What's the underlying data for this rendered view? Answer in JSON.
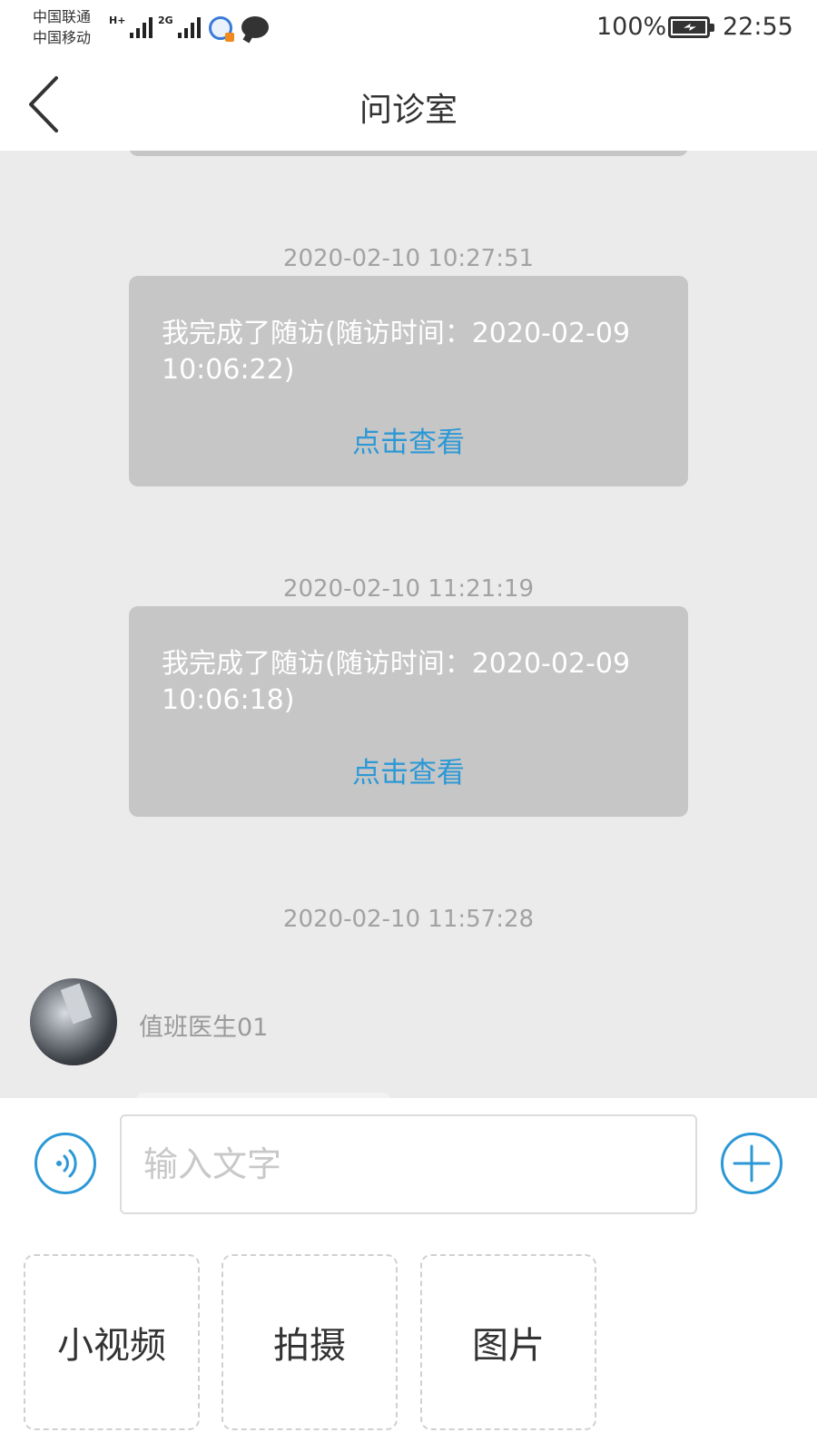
{
  "status_bar": {
    "carrier_1": "中国联通",
    "carrier_2": "中国移动",
    "signal_1_tag": "H+",
    "signal_2_tag": "2G",
    "battery_percent": "100%",
    "time": "22:55"
  },
  "header": {
    "title": "问诊室",
    "back_icon": "chevron-left-icon"
  },
  "messages": [
    {
      "timestamp": "2020-02-10 10:27:51",
      "text": "我完成了随访(随访时间：2020-02-09 10:06:22)",
      "link": "点击查看"
    },
    {
      "timestamp": "2020-02-10 11:21:19",
      "text": "我完成了随访(随访时间：2020-02-09 10:06:18)",
      "link": "点击查看"
    },
    {
      "timestamp": "2020-02-10 11:57:28",
      "sender": "值班医生01"
    }
  ],
  "input": {
    "placeholder": "输入文字",
    "value": "",
    "voice_icon": "voice-wave-icon",
    "plus_icon": "plus-circle-icon"
  },
  "media_options": [
    {
      "label": "小视频"
    },
    {
      "label": "拍摄"
    },
    {
      "label": "图片"
    }
  ],
  "colors": {
    "accent": "#2c98d6",
    "chat_background": "#ebebeb",
    "bubble": "#c6c6c6",
    "timestamp": "#a2a2a2"
  }
}
